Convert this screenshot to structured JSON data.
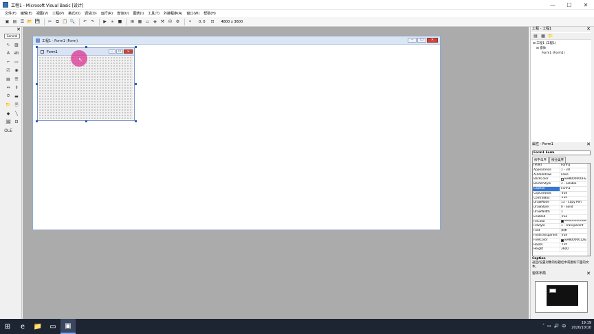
{
  "window": {
    "title": "工程1 - Microsoft Visual Basic [设计]",
    "min": "—",
    "max": "☐",
    "close": "✕"
  },
  "menu": [
    "文件(F)",
    "编辑(E)",
    "视图(V)",
    "工程(P)",
    "格式(O)",
    "调试(D)",
    "运行(R)",
    "查询(U)",
    "图表(I)",
    "工具(T)",
    "外接程序(A)",
    "窗口(W)",
    "帮助(H)"
  ],
  "toolbar": {
    "position": "0, 0",
    "size": "4800 x 3600"
  },
  "toolbox": {
    "tab_label": "General",
    "close": "✕"
  },
  "designer": {
    "title": "工程1 - Form1 (Form)",
    "form_caption": "Form1"
  },
  "project_explorer": {
    "title": "工程 - 工程1",
    "close": "✕",
    "tree": [
      {
        "text": "⊟ 工程1 (工程1)",
        "level": 0
      },
      {
        "text": "⊟ 窗体",
        "level": 1
      },
      {
        "text": "Form1 (Form1)",
        "level": 2
      }
    ]
  },
  "properties": {
    "title": "属性 - Form1",
    "close": "✕",
    "object": "Form1 Form",
    "tab_alpha": "按字母序",
    "tab_category": "按分类序",
    "rows": [
      {
        "name": "(名称)",
        "value": "Form1"
      },
      {
        "name": "Appearance",
        "value": "1 - 3D"
      },
      {
        "name": "AutoRedraw",
        "value": "False"
      },
      {
        "name": "BackColor",
        "value": "&H8000000F&",
        "swatch": "#f0f0f0"
      },
      {
        "name": "BorderStyle",
        "value": "2 - Sizable"
      },
      {
        "name": "Caption",
        "value": "Form1",
        "selected": true
      },
      {
        "name": "ClipControls",
        "value": "True"
      },
      {
        "name": "ControlBox",
        "value": "True"
      },
      {
        "name": "DrawMode",
        "value": "13 - Copy Pen"
      },
      {
        "name": "DrawStyle",
        "value": "0 - Solid"
      },
      {
        "name": "DrawWidth",
        "value": "1"
      },
      {
        "name": "Enabled",
        "value": "True"
      },
      {
        "name": "FillColor",
        "value": "&H00000000&",
        "swatch": "#000000"
      },
      {
        "name": "FillStyle",
        "value": "1 - Transparent"
      },
      {
        "name": "Font",
        "value": "宋体"
      },
      {
        "name": "FontTransparent",
        "value": "True"
      },
      {
        "name": "ForeColor",
        "value": "&H80000012&",
        "swatch": "#000000"
      },
      {
        "name": "HasDC",
        "value": "True"
      },
      {
        "name": "Height",
        "value": "3600"
      }
    ],
    "desc_name": "Caption",
    "desc_text": "返回/设置对象的标题栏中或图标下面的文本。"
  },
  "form_layout": {
    "title": "窗体布局",
    "close": "✕"
  },
  "taskbar": {
    "time": "19:19",
    "date": "2020/10/10",
    "ime": "中"
  }
}
